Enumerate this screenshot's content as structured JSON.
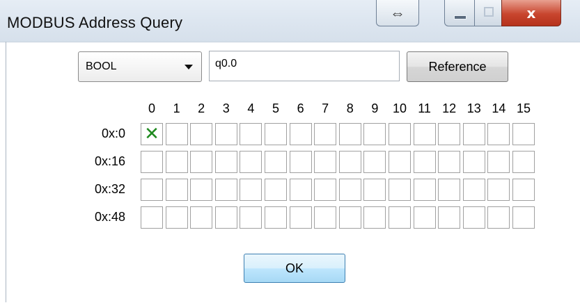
{
  "window": {
    "title": "MODBUS Address Query",
    "resize_icon": "⇔",
    "close_icon": "x"
  },
  "toolbar": {
    "type_select": {
      "value": "BOOL"
    },
    "address_input": {
      "value": "q0.0"
    },
    "reference_label": "Reference"
  },
  "grid": {
    "columns": [
      "0",
      "1",
      "2",
      "3",
      "4",
      "5",
      "6",
      "7",
      "8",
      "9",
      "10",
      "11",
      "12",
      "13",
      "14",
      "15"
    ],
    "rows": [
      {
        "label": "0x:0",
        "checked": [
          0
        ]
      },
      {
        "label": "0x:16",
        "checked": []
      },
      {
        "label": "0x:32",
        "checked": []
      },
      {
        "label": "0x:48",
        "checked": []
      }
    ],
    "check_glyph": "✕",
    "check_color": "#1f8a1f"
  },
  "ok_label": "OK"
}
